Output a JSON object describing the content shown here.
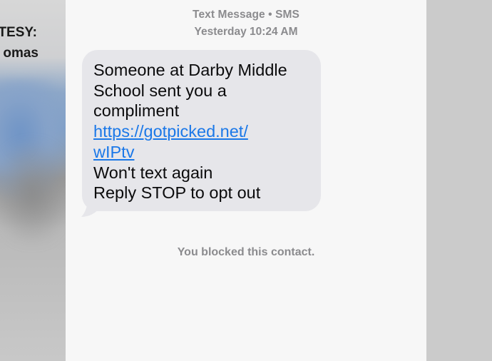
{
  "background": {
    "credit_line_1": "TESY:",
    "credit_line_2": "omas"
  },
  "conversation": {
    "service_label": "Text Message • SMS",
    "timestamp": "Yesterday 10:24 AM",
    "message": {
      "lines_before_link": [
        "Someone at Darby Middle",
        "School sent you a",
        "compliment"
      ],
      "link_lines": [
        "https://gotpicked.net/",
        "wIPtv"
      ],
      "lines_after_link": [
        "Won't text again",
        "Reply STOP to opt out"
      ]
    },
    "blocked_notice": "You blocked this contact."
  },
  "colors": {
    "bubble": "#e6e6ea",
    "link": "#1b78e8",
    "meta_text": "#8b8b8e",
    "screen_background": "#f7f7f7"
  }
}
